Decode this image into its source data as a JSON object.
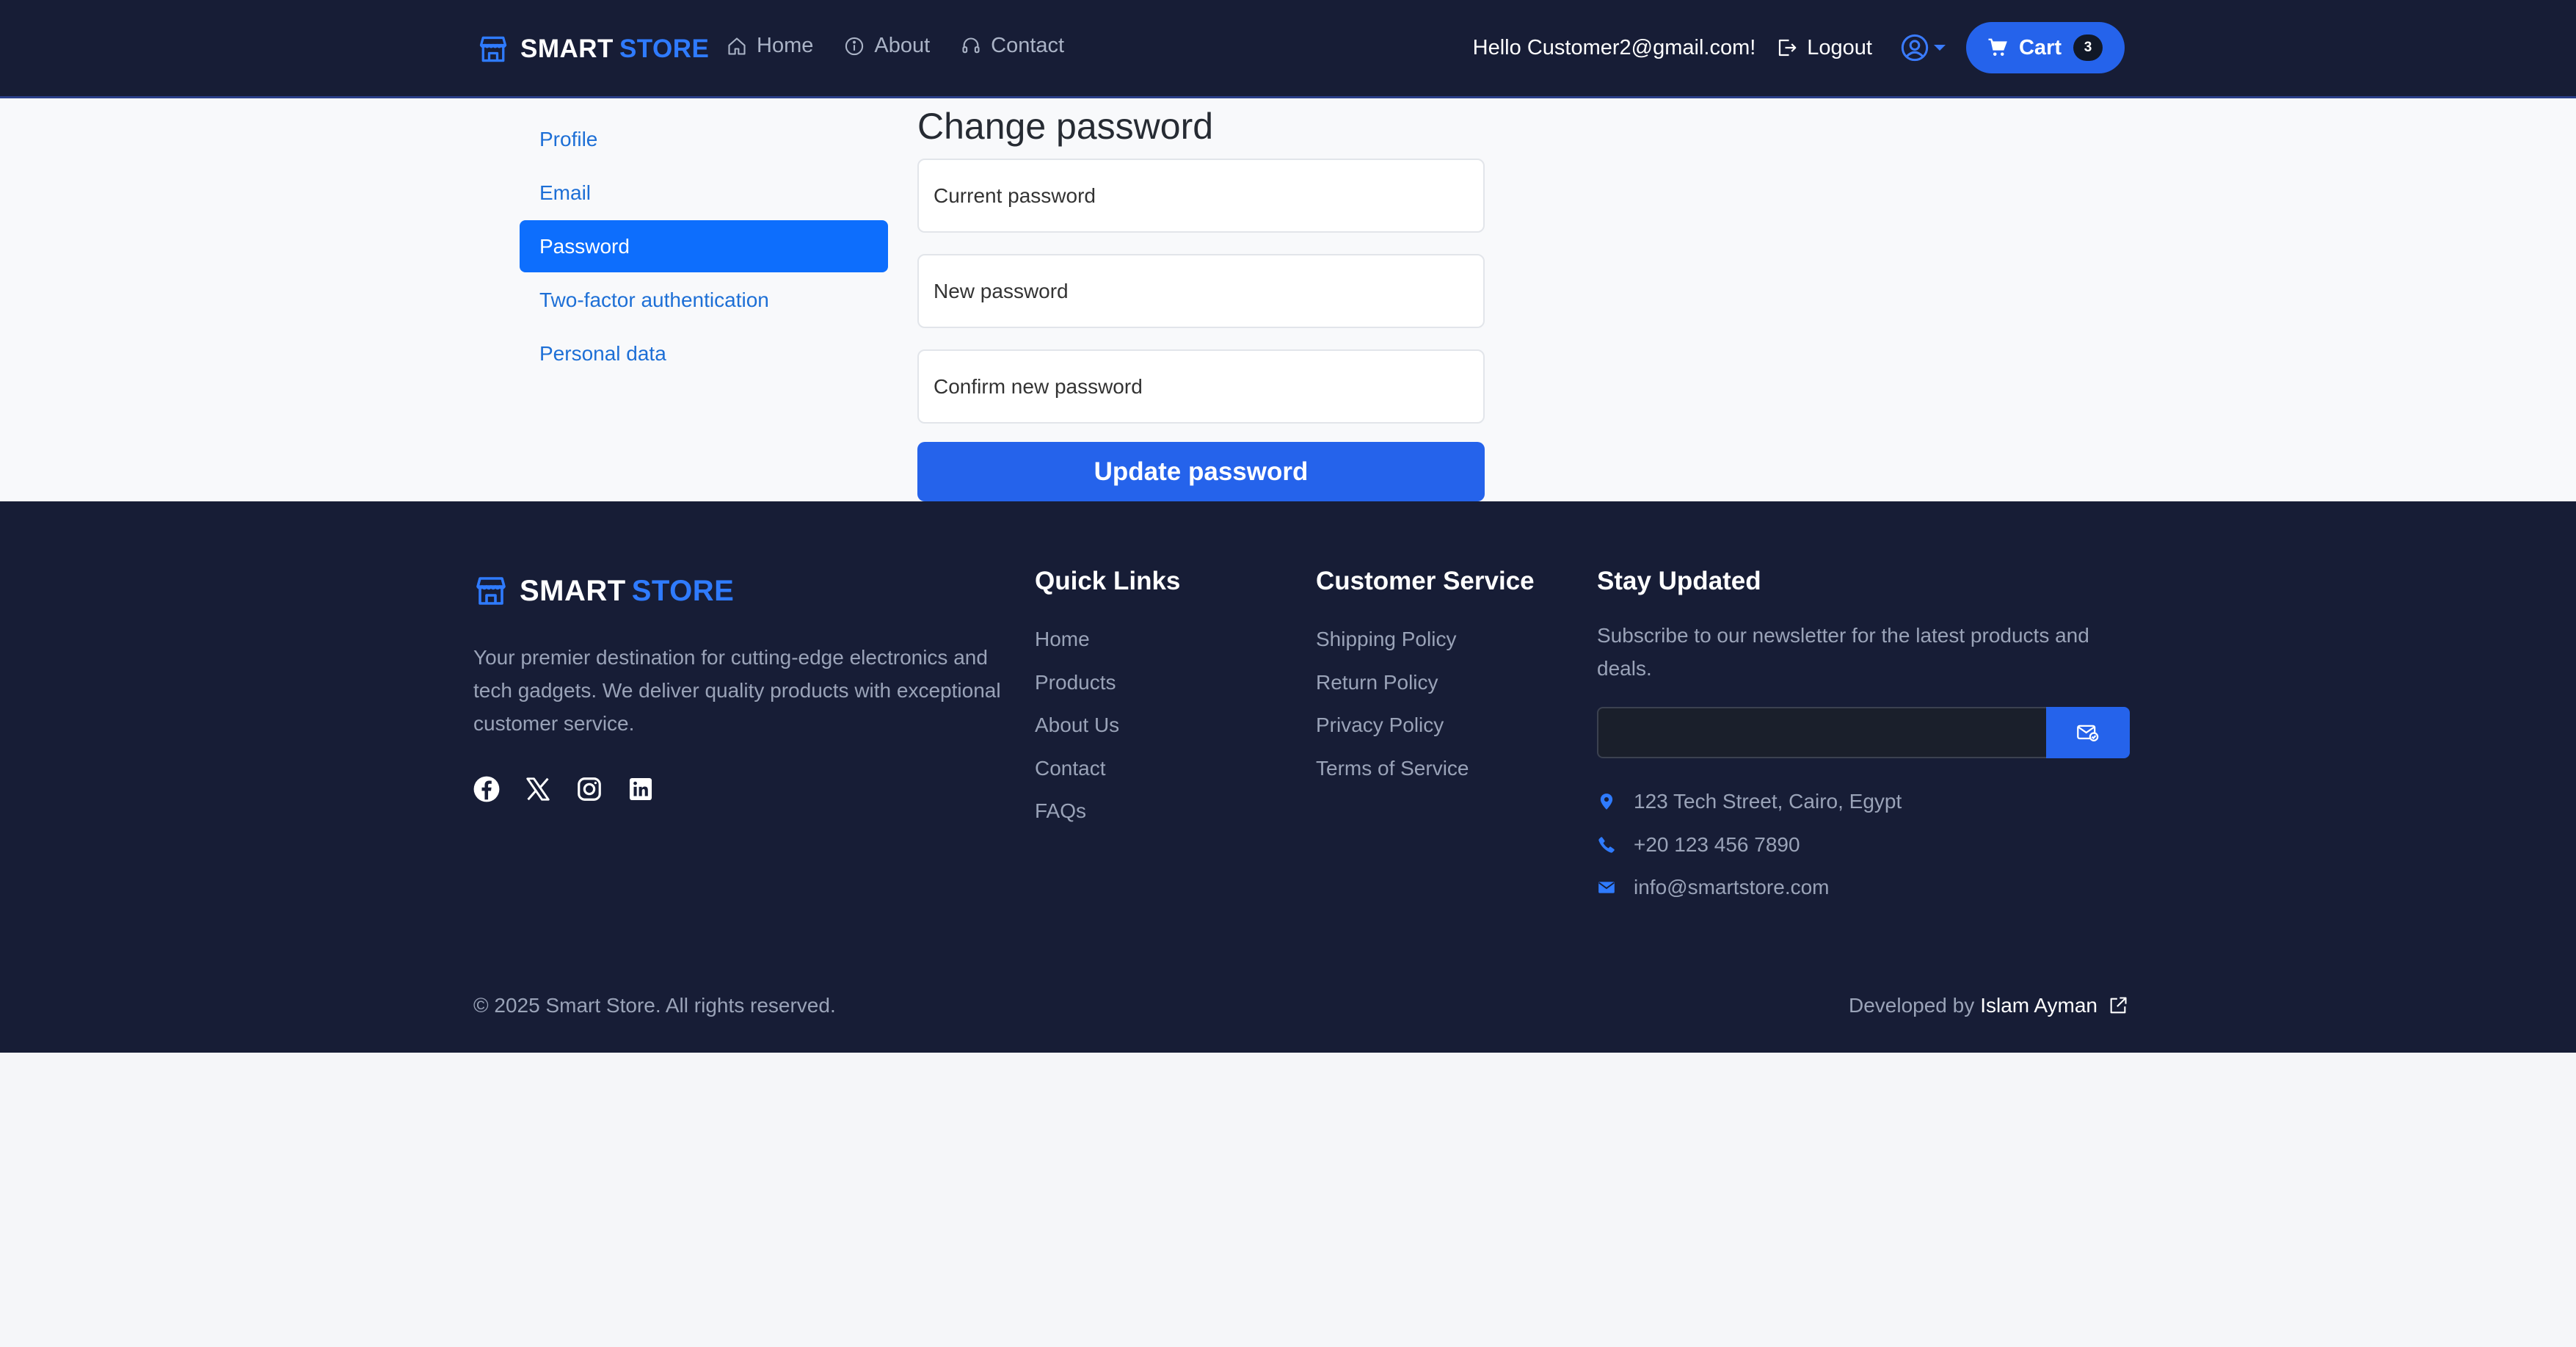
{
  "navbar": {
    "brand_part1": "SMART",
    "brand_part2": "STORE",
    "links": [
      {
        "label": "Home",
        "icon": "home-icon"
      },
      {
        "label": "About",
        "icon": "info-icon"
      },
      {
        "label": "Contact",
        "icon": "headset-icon"
      }
    ],
    "greeting": "Hello Customer2@gmail.com!",
    "logout_label": "Logout",
    "cart_label": "Cart",
    "cart_count": "3"
  },
  "sidebar": {
    "items": [
      {
        "label": "Profile",
        "active": false
      },
      {
        "label": "Email",
        "active": false
      },
      {
        "label": "Password",
        "active": true
      },
      {
        "label": "Two-factor authentication",
        "active": false
      },
      {
        "label": "Personal data",
        "active": false
      }
    ]
  },
  "form": {
    "title": "Change password",
    "current_placeholder": "Current password",
    "new_placeholder": "New password",
    "confirm_placeholder": "Confirm new password",
    "submit_label": "Update password"
  },
  "footer": {
    "brand_part1": "SMART",
    "brand_part2": "STORE",
    "description": "Your premier destination for cutting-edge electronics and tech gadgets. We deliver quality products with exceptional customer service.",
    "quick_links": {
      "title": "Quick Links",
      "items": [
        "Home",
        "Products",
        "About Us",
        "Contact",
        "FAQs"
      ]
    },
    "customer_service": {
      "title": "Customer Service",
      "items": [
        "Shipping Policy",
        "Return Policy",
        "Privacy Policy",
        "Terms of Service"
      ]
    },
    "stay_updated": {
      "title": "Stay Updated",
      "text": "Subscribe to our newsletter for the latest products and deals.",
      "email_value": ""
    },
    "contact": {
      "address": "123 Tech Street, Cairo, Egypt",
      "phone": "+20 123 456 7890",
      "email": "info@smartstore.com"
    },
    "copyright": "© 2025 Smart Store. All rights reserved.",
    "developed_by": "Developed by",
    "author": "Islam Ayman"
  },
  "colors": {
    "navbar_bg": "#171d36",
    "accent": "#2563eb",
    "brand_blue": "#2f7bff",
    "sidebar_active": "#0d6efd",
    "link_blue": "#1d6fd6"
  }
}
